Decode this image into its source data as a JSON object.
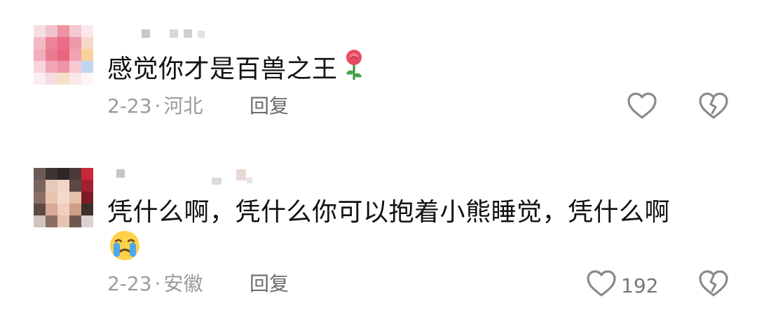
{
  "comments": [
    {
      "text": "感觉你才是百兽之王",
      "text_emoji": "rose-emoji",
      "date": "2-23",
      "separator": "·",
      "location": "河北",
      "reply_label": "回复",
      "like_count": ""
    },
    {
      "text": "凭什么啊，凭什么你可以抱着小熊睡觉，凭什么啊",
      "text_emoji": "crying-face-emoji",
      "date": "2-23",
      "separator": "·",
      "location": "安徽",
      "reply_label": "回复",
      "like_count": "192"
    }
  ],
  "icons": {
    "like": "heart-outline-icon",
    "dislike": "broken-heart-icon"
  },
  "colors": {
    "text": "#111111",
    "meta": "#9a9a9a",
    "icon": "#8a8a8a"
  }
}
